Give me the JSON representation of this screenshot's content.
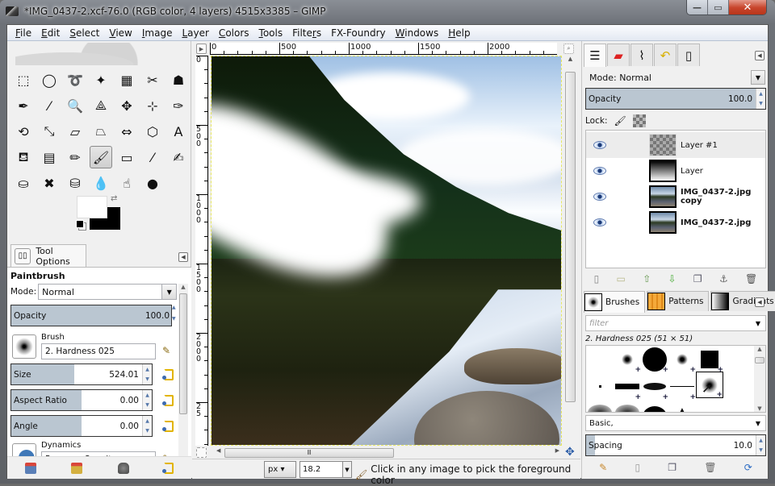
{
  "window": {
    "title": "*IMG_0437-2.xcf-76.0 (RGB color, 4 layers) 4515x3385 – GIMP",
    "controls": {
      "minimize": "—",
      "maximize": "▭",
      "close": "✕"
    }
  },
  "menu": [
    "File",
    "Edit",
    "Select",
    "View",
    "Image",
    "Layer",
    "Colors",
    "Tools",
    "Filters",
    "FX-Foundry",
    "Windows",
    "Help"
  ],
  "menu_mnemonics": [
    "F",
    "E",
    "S",
    "V",
    "I",
    "L",
    "C",
    "T",
    "r",
    "",
    "W",
    "H"
  ],
  "toolbox": {
    "tools": [
      {
        "name": "rect-select",
        "glyph": "⬚"
      },
      {
        "name": "ellipse-select",
        "glyph": "◯"
      },
      {
        "name": "free-select",
        "glyph": "➰"
      },
      {
        "name": "fuzzy-select",
        "glyph": "✦"
      },
      {
        "name": "select-by-color",
        "glyph": "▦"
      },
      {
        "name": "scissors-select",
        "glyph": "✂"
      },
      {
        "name": "foreground-select",
        "glyph": "☗"
      },
      {
        "name": "paths",
        "glyph": "✒"
      },
      {
        "name": "color-picker",
        "glyph": "⁄"
      },
      {
        "name": "zoom",
        "glyph": "🔍"
      },
      {
        "name": "measure",
        "glyph": "⟁"
      },
      {
        "name": "move",
        "glyph": "✥"
      },
      {
        "name": "align",
        "glyph": "⊹"
      },
      {
        "name": "crop",
        "glyph": "✑"
      },
      {
        "name": "rotate",
        "glyph": "⟲"
      },
      {
        "name": "scale",
        "glyph": "⤡"
      },
      {
        "name": "shear",
        "glyph": "▱"
      },
      {
        "name": "perspective",
        "glyph": "⏢"
      },
      {
        "name": "flip",
        "glyph": "⇔"
      },
      {
        "name": "cage-transform",
        "glyph": "⬡"
      },
      {
        "name": "text",
        "glyph": "A"
      },
      {
        "name": "bucket-fill",
        "glyph": "⛾"
      },
      {
        "name": "blend",
        "glyph": "▤"
      },
      {
        "name": "pencil",
        "glyph": "✏"
      },
      {
        "name": "paintbrush",
        "glyph": "🖌"
      },
      {
        "name": "eraser",
        "glyph": "▭"
      },
      {
        "name": "airbrush",
        "glyph": "⁄"
      },
      {
        "name": "ink",
        "glyph": "✍"
      },
      {
        "name": "clone",
        "glyph": "⛀"
      },
      {
        "name": "heal",
        "glyph": "✖"
      },
      {
        "name": "perspective-clone",
        "glyph": "⛁"
      },
      {
        "name": "blur-sharpen",
        "glyph": "💧"
      },
      {
        "name": "smudge",
        "glyph": "☝"
      },
      {
        "name": "dodge-burn",
        "glyph": "●"
      }
    ],
    "active_tool": "paintbrush",
    "fg_color": "#ffffff",
    "bg_color": "#000000"
  },
  "tool_options": {
    "tab_label": "Tool Options",
    "title": "Paintbrush",
    "mode_label": "Mode:",
    "mode_value": "Normal",
    "opacity": {
      "label": "Opacity",
      "value": "100.0",
      "fraction": 1.0
    },
    "brush": {
      "label": "Brush",
      "value": "2. Hardness 025"
    },
    "size": {
      "label": "Size",
      "value": "524.01",
      "fraction": 0.45
    },
    "aspect_ratio": {
      "label": "Aspect Ratio",
      "value": "0.00",
      "fraction": 0.5
    },
    "angle": {
      "label": "Angle",
      "value": "0.00",
      "fraction": 0.5
    },
    "dynamics": {
      "label": "Dynamics",
      "value": "Pressure Opacity"
    }
  },
  "canvas": {
    "hruler_labels": [
      "0",
      "500",
      "1000",
      "1500",
      "2000"
    ],
    "vruler_labels": [
      "0",
      "500",
      "1000",
      "1500",
      "2000",
      "25"
    ],
    "unit": "px",
    "zoom": "18.2",
    "status_message": "Click in any image to pick the foreground color"
  },
  "layers_panel": {
    "mode_label": "Mode:",
    "mode_value": "Normal",
    "opacity": {
      "label": "Opacity",
      "value": "100.0",
      "fraction": 1.0
    },
    "lock_label": "Lock:",
    "layers": [
      {
        "name": "Layer #1",
        "bold": false,
        "selected": true,
        "visible": true,
        "thumb": "checker"
      },
      {
        "name": "Layer",
        "bold": false,
        "selected": false,
        "visible": true,
        "thumb": "gradient"
      },
      {
        "name": "IMG_0437-2.jpg copy",
        "bold": true,
        "selected": false,
        "visible": true,
        "thumb": "photo"
      },
      {
        "name": "IMG_0437-2.jpg",
        "bold": true,
        "selected": false,
        "visible": true,
        "thumb": "photo"
      }
    ]
  },
  "brushes_panel": {
    "tabs": [
      {
        "label": "Brushes"
      },
      {
        "label": "Patterns"
      },
      {
        "label": "Gradients"
      }
    ],
    "filter_placeholder": "filter",
    "current_brush": "2. Hardness 025 (51 × 51)",
    "tag": "Basic,",
    "spacing": {
      "label": "Spacing",
      "value": "10.0",
      "fraction": 0.05
    }
  }
}
